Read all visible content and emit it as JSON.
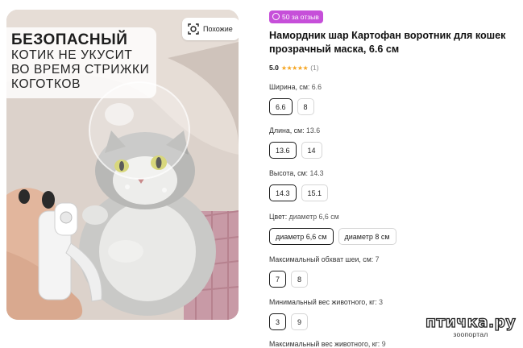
{
  "image": {
    "promo_line1": "БЕЗОПАСНЫЙ",
    "promo_line2": "КОТИК НЕ УКУСИТ",
    "promo_line3": "ВО ВРЕМЯ СТРИЖКИ",
    "promo_line4": "КОГОТКОВ",
    "similar_label": "Похожие",
    "similar_icon": "visual-search-icon"
  },
  "product": {
    "reviews_badge": "50 за отзыв",
    "reviews_badge_color": "#c64fd9",
    "title": "Намордник шар Картофан воротник для кошек прозрачный маска, 6.6 см",
    "rating_value": "5.0",
    "rating_stars": 5,
    "rating_count": "(1)",
    "star_color": "#f5a623"
  },
  "attributes": [
    {
      "label": "Ширина, см:",
      "value": "6.6",
      "options": [
        "6.6",
        "8"
      ],
      "selected": 0
    },
    {
      "label": "Длина, см:",
      "value": "13.6",
      "options": [
        "13.6",
        "14"
      ],
      "selected": 0
    },
    {
      "label": "Высота, см:",
      "value": "14.3",
      "options": [
        "14.3",
        "15.1"
      ],
      "selected": 0
    },
    {
      "label": "Цвет:",
      "value": "диаметр 6,6 см",
      "options": [
        "диаметр 6,6 см",
        "диаметр 8 см"
      ],
      "selected": 0
    },
    {
      "label": "Максимальный обхват шеи, см:",
      "value": "7",
      "options": [
        "7",
        "8"
      ],
      "selected": 0
    },
    {
      "label": "Минимальный вес животного, кг:",
      "value": "3",
      "options": [
        "3",
        "9"
      ],
      "selected": 0
    },
    {
      "label": "Максимальный вес животного, кг:",
      "value": "9",
      "options": [],
      "selected": -1
    }
  ],
  "watermark": {
    "line1": "птичка.ру",
    "line2": "зоопортал"
  }
}
